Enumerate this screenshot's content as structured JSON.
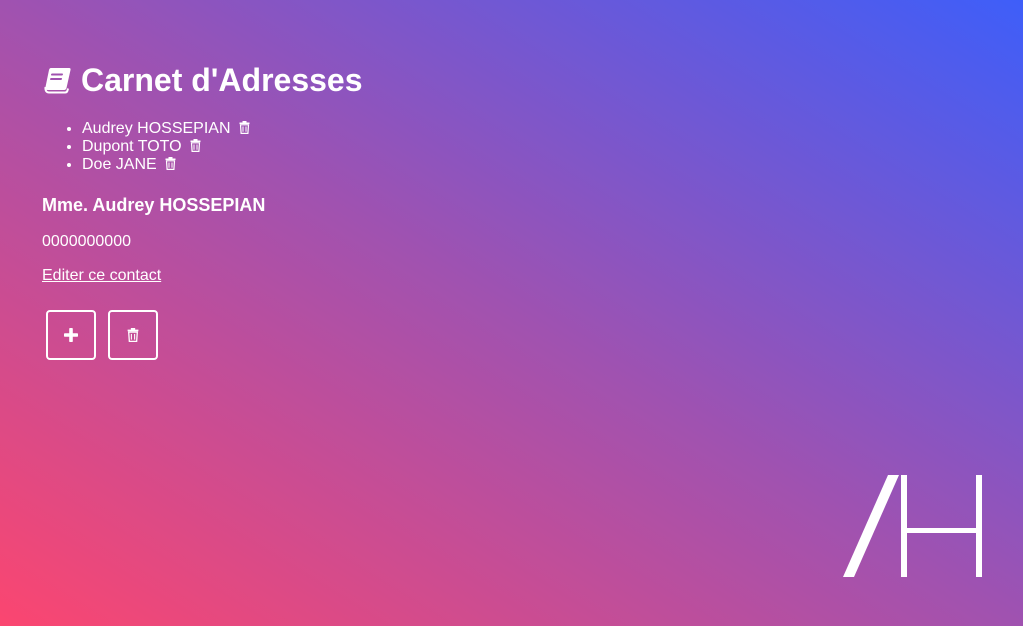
{
  "header": {
    "title": "Carnet d'Adresses",
    "icon": "book-icon"
  },
  "contacts": [
    {
      "name": "Audrey HOSSEPIAN",
      "action_icon": "trash-icon"
    },
    {
      "name": "Dupont TOTO",
      "action_icon": "trash-icon"
    },
    {
      "name": "Doe JANE",
      "action_icon": "trash-icon"
    }
  ],
  "detail": {
    "full_name": "Mme. Audrey HOSSEPIAN",
    "phone": "0000000000",
    "edit_link": "Editer ce contact"
  },
  "actions": {
    "add_icon": "plus-icon",
    "delete_icon": "trash-icon"
  },
  "logo": {
    "text": "AH"
  },
  "colors": {
    "gradient_start": "#fb4670",
    "gradient_mid": "#a052b0",
    "gradient_end": "#3e5ef9",
    "foreground": "#ffffff"
  }
}
